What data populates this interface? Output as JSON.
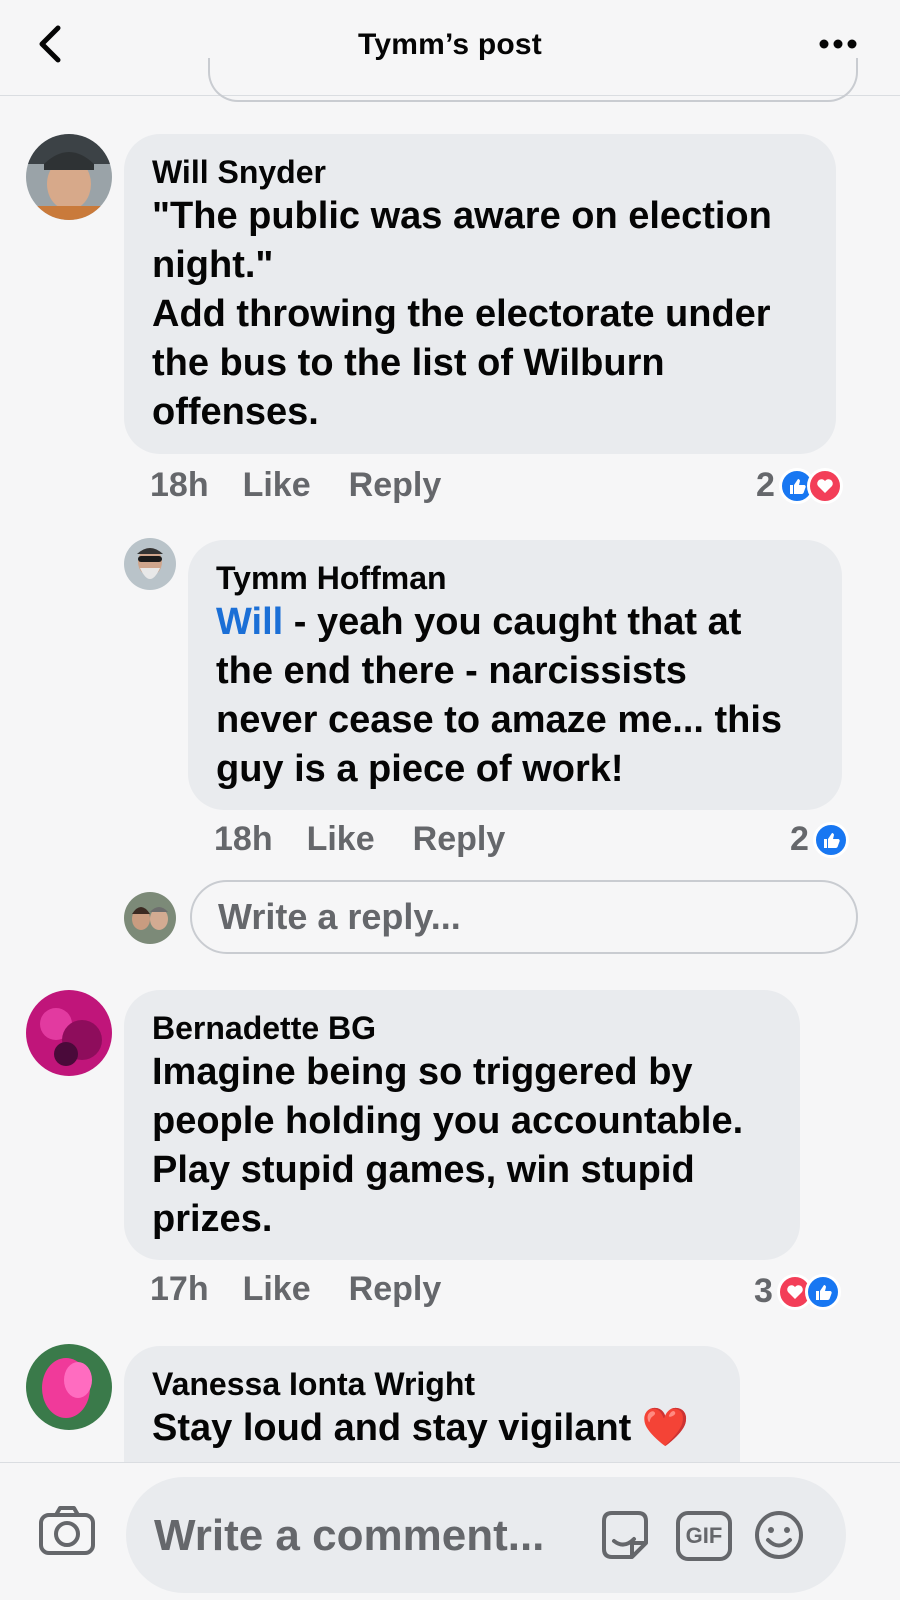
{
  "header": {
    "title": "Tymm’s post"
  },
  "comments": [
    {
      "author": "Will Snyder",
      "lines": [
        "\"The public was aware on election",
        "night.\"",
        "Add throwing the electorate under",
        "the bus to the list of Wilburn",
        "offenses."
      ],
      "time": "18h",
      "like": "Like",
      "reply": "Reply",
      "reaction_count": "2"
    },
    {
      "author": "Tymm Hoffman",
      "mention": "Will",
      "lines": [
        " - yeah you caught that at",
        "the end there - narcissists",
        "never cease to amaze me... this",
        "guy is a piece of work!"
      ],
      "time": "18h",
      "like": "Like",
      "reply": "Reply",
      "reaction_count": "2"
    },
    {
      "author": "Bernadette BG",
      "lines": [
        "Imagine being so triggered by",
        "people holding you accountable.",
        "Play stupid games, win stupid",
        "prizes."
      ],
      "time": "17h",
      "like": "Like",
      "reply": "Reply",
      "reaction_count": "3"
    },
    {
      "author": "Vanessa Ionta Wright",
      "lines": [
        "Stay loud and stay vigilant ❤️"
      ]
    }
  ],
  "reply_input": {
    "placeholder": "Write a reply..."
  },
  "composer": {
    "placeholder": "Write a comment...",
    "gif_label": "GIF"
  },
  "colors": {
    "like": "#1877f2",
    "love": "#f33e58",
    "mention": "#1b6fd6"
  }
}
